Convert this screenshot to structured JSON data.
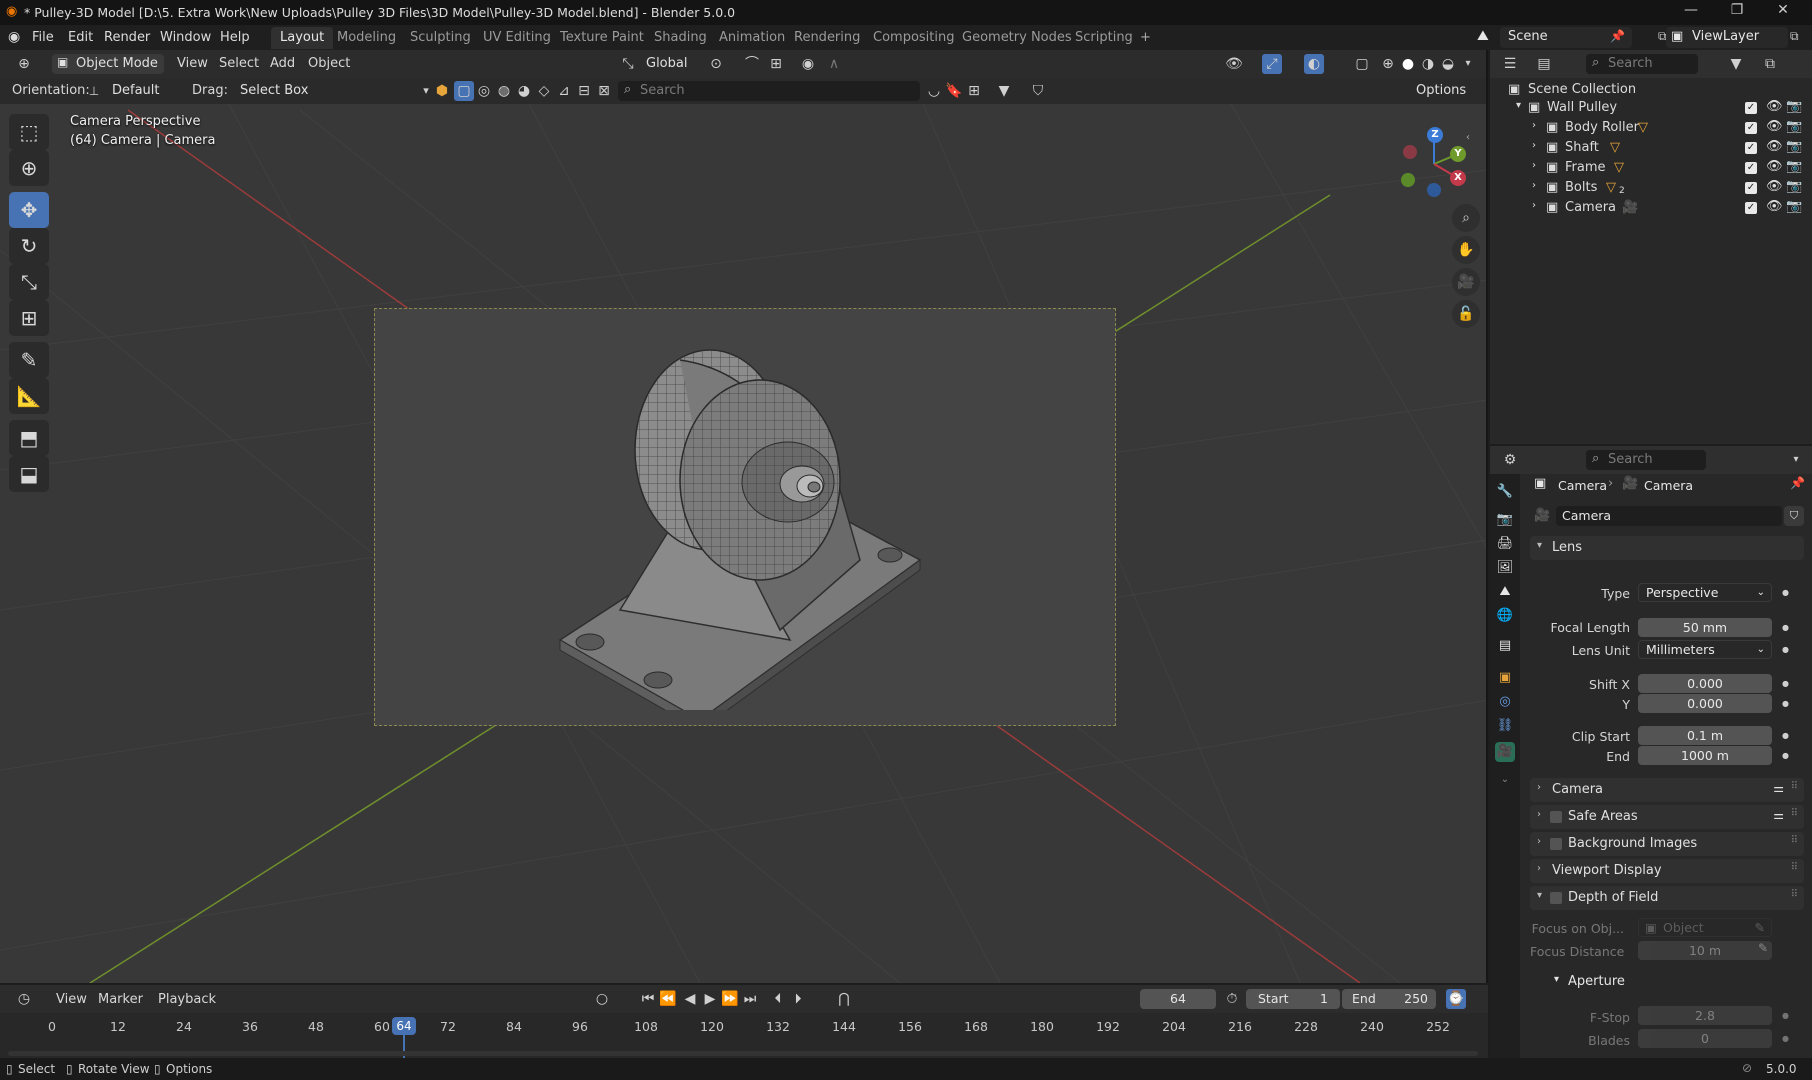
{
  "window": {
    "title": "* Pulley-3D Model [D:\\5. Extra Work\\New Uploads\\Pulley 3D Files\\3D Model\\Pulley-3D Model.blend] - Blender 5.0.0",
    "minimize": "—",
    "maximize": "❐",
    "close": "✕"
  },
  "menu": [
    "File",
    "Edit",
    "Render",
    "Window",
    "Help"
  ],
  "workspaces": [
    "Layout",
    "Modeling",
    "Sculpting",
    "UV Editing",
    "Texture Paint",
    "Shading",
    "Animation",
    "Rendering",
    "Compositing",
    "Geometry Nodes",
    "Scripting"
  ],
  "add_workspace": "+",
  "scene": {
    "label": "Scene",
    "view_layer": "ViewLayer"
  },
  "viewport_header": {
    "mode": "Object Mode",
    "menus": [
      "View",
      "Select",
      "Add",
      "Object"
    ],
    "transform": "Global",
    "orientation_label": "Orientation:",
    "orientation_value": "Default",
    "drag_label": "Drag:",
    "drag_value": "Select Box",
    "search_placeholder": "Search",
    "options": "Options"
  },
  "viewport": {
    "overlay_line1": "Camera Perspective",
    "overlay_line2": "(64) Camera | Camera",
    "gizmo": {
      "z": "Z",
      "y": "Y",
      "x": "X"
    }
  },
  "outliner": {
    "search_placeholder": "Search",
    "root": "Scene Collection",
    "collection": "Wall Pulley",
    "items": [
      "Body Roller",
      "Shaft",
      "Frame",
      "Bolts",
      "Camera"
    ],
    "bolts_badge": "2"
  },
  "properties": {
    "search_placeholder": "Search",
    "breadcrumb": [
      "Camera",
      "Camera"
    ],
    "data_name": "Camera",
    "lens_panel": "Lens",
    "type_label": "Type",
    "type_value": "Perspective",
    "focal_label": "Focal Length",
    "focal_value": "50 mm",
    "lens_unit_label": "Lens Unit",
    "lens_unit_value": "Millimeters",
    "shift_x_label": "Shift X",
    "shift_x_value": "0.000",
    "shift_y_label": "Y",
    "shift_y_value": "0.000",
    "clip_start_label": "Clip Start",
    "clip_start_value": "0.1 m",
    "clip_end_label": "End",
    "clip_end_value": "1000 m",
    "panels": [
      "Camera",
      "Safe Areas",
      "Background Images",
      "Viewport Display",
      "Depth of Field"
    ],
    "focus_obj_label": "Focus on Obj...",
    "focus_obj_placeholder": "Object",
    "focus_dist_label": "Focus Distance",
    "focus_dist_value": "10 m",
    "aperture_panel": "Aperture",
    "fstop_label": "F-Stop",
    "fstop_value": "2.8",
    "blades_label": "Blades",
    "blades_value": "0"
  },
  "timeline": {
    "menus": [
      "View",
      "Marker",
      "Playback"
    ],
    "current_frame": "64",
    "start_label": "Start",
    "start_value": "1",
    "end_label": "End",
    "end_value": "250",
    "ticks": [
      "0",
      "12",
      "24",
      "36",
      "48",
      "60",
      "72",
      "84",
      "96",
      "108",
      "120",
      "132",
      "144",
      "156",
      "168",
      "180",
      "192",
      "204",
      "216",
      "228",
      "240",
      "252"
    ],
    "playhead": "64"
  },
  "statusbar": {
    "select": "Select",
    "rotate": "Rotate View",
    "options": "Options",
    "version": "5.0.0"
  }
}
